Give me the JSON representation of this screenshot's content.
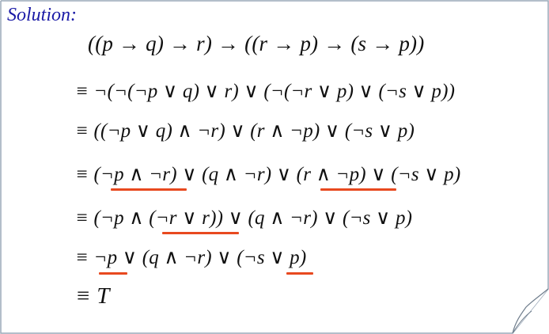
{
  "slide": {
    "heading": "Solution:",
    "statement": "((p → q) → r) → ((r → p) → (s → p))",
    "steps": [
      "≡ ¬(¬(¬p ∨ q) ∨ r) ∨ (¬(¬r ∨ p) ∨ (¬s ∨ p))",
      "≡ ((¬p ∨ q) ∧ ¬r) ∨ (r ∧ ¬p) ∨ (¬s ∨ p)",
      "≡ (¬p ∧ ¬r) ∨ (q ∧ ¬r) ∨ (r ∧ ¬p) ∨ (¬s ∨ p)",
      "≡ (¬p ∧ (¬r ∨ r)) ∨ (q ∧ ¬r) ∨ (¬s ∨ p)",
      "≡ ¬p ∨ (q ∧ ¬r) ∨ (¬s ∨ p)",
      "≡ T"
    ]
  },
  "colors": {
    "heading": "#1a1aa6",
    "text": "#111111",
    "highlight": "#e8491f",
    "border": "#9aa8b8"
  }
}
